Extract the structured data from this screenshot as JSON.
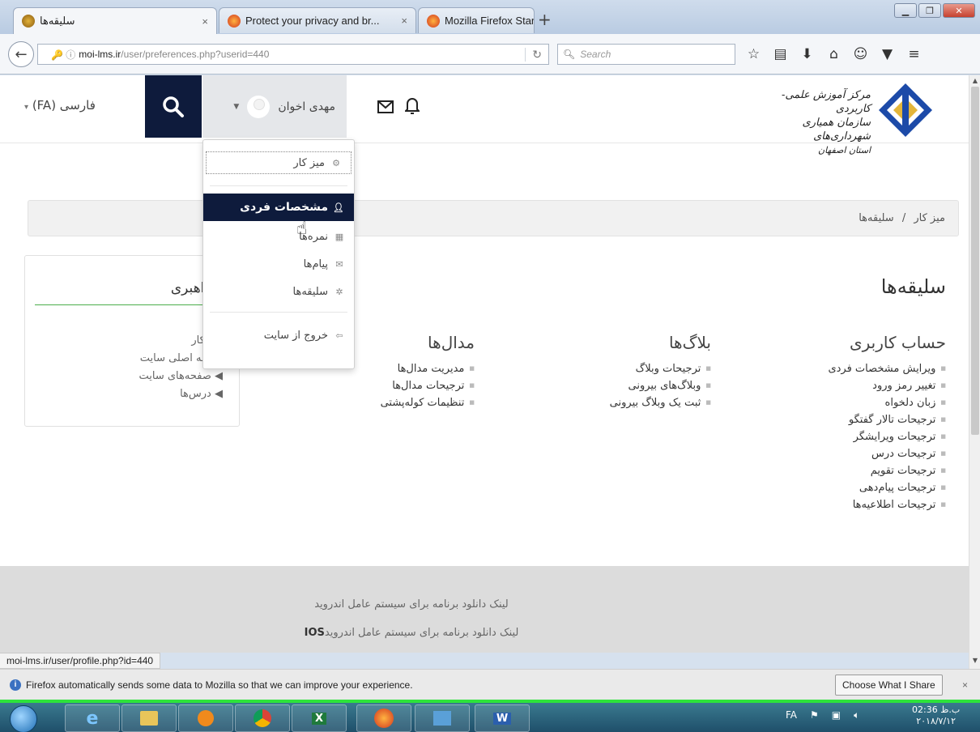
{
  "browser": {
    "tabs": [
      {
        "label": "سلیقه‌ها",
        "close": "×"
      },
      {
        "label": "Protect your privacy and br...",
        "close": "×"
      },
      {
        "label": "Mozilla Firefox Start Page",
        "close": "×"
      }
    ],
    "new_tab": "+",
    "url_host": "moi-lms.ir",
    "url_path": "/user/preferences.php?userid=440",
    "search_placeholder": "Search",
    "status_url": "moi-lms.ir/user/profile.php?id=440",
    "infobar_text": "Firefox automatically sends some data to Mozilla so that we can improve your experience.",
    "infobar_button": "Choose What I Share",
    "infobar_close": "×"
  },
  "header": {
    "language": "فارسی (FA)",
    "user_name": "مهدی اخوان",
    "logo_text": [
      "مرکز آموزش علمی-کاربردی",
      "سازمان همیاری شهرداری‌های",
      "استان اصفهان"
    ]
  },
  "user_dropdown": {
    "items": [
      {
        "label": "میز کار",
        "icon": "dashboard-icon"
      },
      {
        "label": "مشخصات فردی",
        "icon": "user-icon"
      },
      {
        "label": "نمره‌ها",
        "icon": "grades-icon"
      },
      {
        "label": "پیام‌ها",
        "icon": "envelope-icon"
      },
      {
        "label": "سلیقه‌ها",
        "icon": "gear-icon"
      },
      {
        "label": "خروج از سایت",
        "icon": "logout-icon"
      }
    ]
  },
  "breadcrumb": {
    "home": "میز کار",
    "separator": "/",
    "current": "سلیقه‌ها"
  },
  "sidebar": {
    "title": "راهبری",
    "items": [
      "میز کار",
      "صفحه اصلی سایت",
      "صفحه‌های سایت",
      "درس‌ها"
    ]
  },
  "main": {
    "title": "سلیقه‌ها",
    "columns": [
      {
        "heading": "حساب کاربری",
        "links": [
          "ویرایش مشخصات فردی",
          "تغییر رمز ورود",
          "زبان دلخواه",
          "ترجیحات تالار گفتگو",
          "ترجیحات ویرایشگر",
          "ترجیحات درس",
          "ترجیحات تقویم",
          "ترجیحات پیام‌دهی",
          "ترجیحات اطلاعیه‌ها"
        ]
      },
      {
        "heading": "بلاگ‌ها",
        "links": [
          "ترجیحات وبلاگ",
          "وبلاگ‌های بیرونی",
          "ثبت یک وبلاگ بیرونی"
        ]
      },
      {
        "heading": "مدال‌ها",
        "links": [
          "مدیریت مدال‌ها",
          "ترجیحات مدال‌ها",
          "تنظیمات کوله‌پشتی"
        ]
      }
    ]
  },
  "footer": {
    "line1": "لینک دانلود برنامه برای سیستم عامل اندروید",
    "line2_prefix": "لینک دانلود برنامه برای سیستم عامل اندروید",
    "line2_bold": "IOS"
  },
  "taskbar": {
    "lang": "FA",
    "clock_time": "02:36 ب.ظ",
    "clock_date": "۲۰۱۸/۷/۱۲"
  },
  "colors": {
    "nav_dark": "#0e1b3c",
    "accent_green": "#4cae4c",
    "footer_gray": "#dcdcdc"
  }
}
